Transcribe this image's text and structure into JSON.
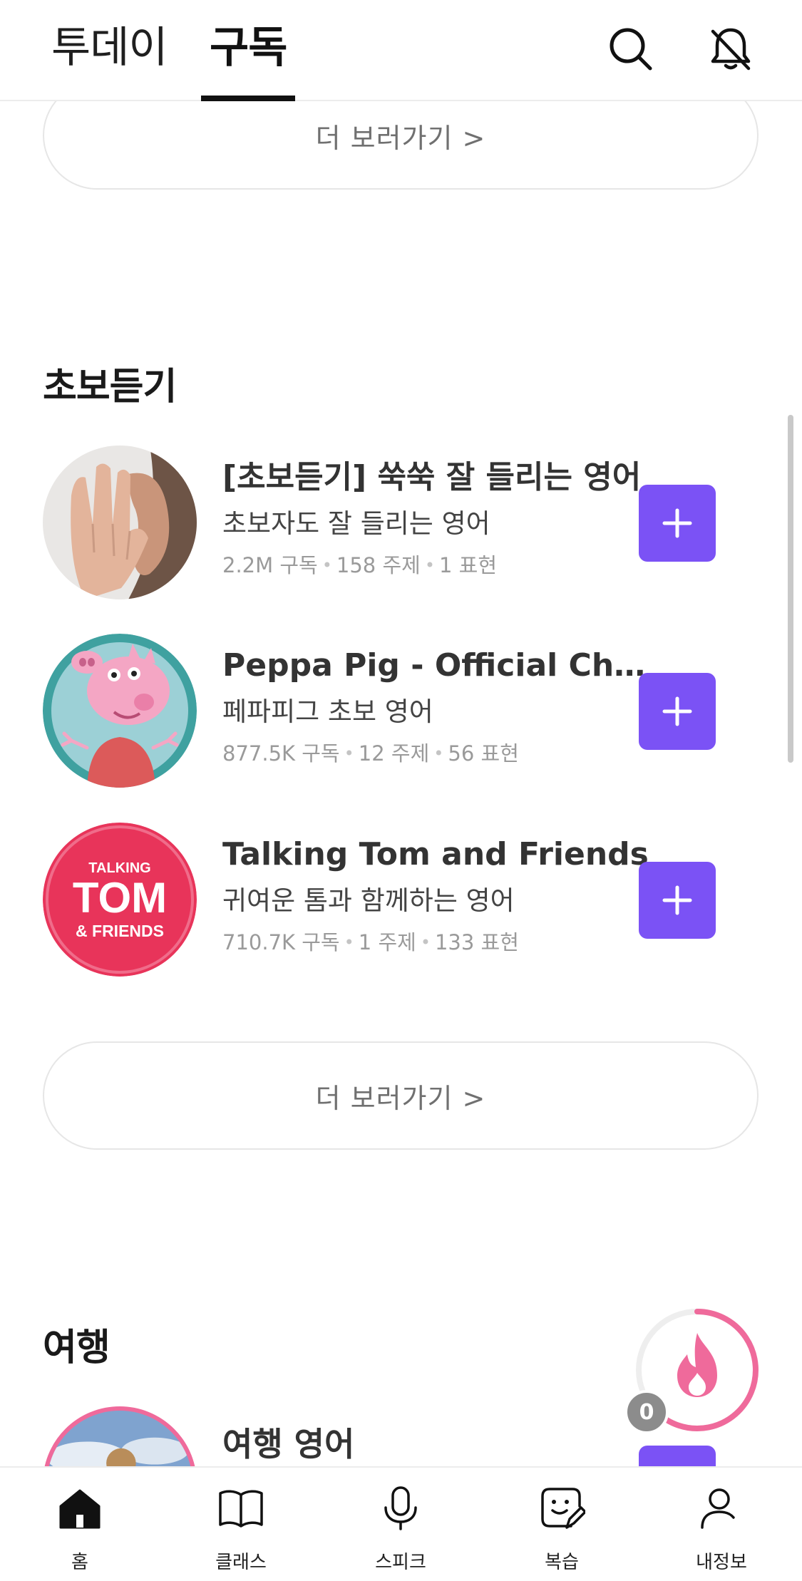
{
  "header": {
    "tabs": [
      {
        "label": "투데이",
        "active": false
      },
      {
        "label": "구독",
        "active": true
      }
    ],
    "icons": [
      "search-icon",
      "bell-off-icon"
    ]
  },
  "more_label": "더 보러가기  >",
  "sections": {
    "beginner": {
      "title": "초보듣기",
      "channels": [
        {
          "title": "[초보듣기] 쑥쑥 잘 들리는 영어",
          "subtitle": "초보자도 잘 들리는 영어",
          "subscribers": "2.2M 구독",
          "topics": "158 주제",
          "expressions": "1 표현"
        },
        {
          "title": "Peppa Pig - Official Channel",
          "subtitle": "페파피그 초보 영어",
          "subscribers": "877.5K 구독",
          "topics": "12 주제",
          "expressions": "56 표현"
        },
        {
          "title": "Talking Tom and Friends",
          "subtitle": "귀여운 톰과 함께하는 영어",
          "subscribers": "710.7K 구독",
          "topics": "1 주제",
          "expressions": "133 표현",
          "logo_text": [
            "TALKING",
            "TOM",
            "& FRIENDS"
          ]
        }
      ]
    },
    "travel": {
      "title": "여행",
      "channels": [
        {
          "title": "여행 영어"
        }
      ]
    }
  },
  "streak": {
    "count": "0",
    "icon": "flame-icon"
  },
  "bottom_nav": [
    {
      "label": "홈",
      "icon": "home-icon",
      "active": true
    },
    {
      "label": "클래스",
      "icon": "book-icon"
    },
    {
      "label": "스피크",
      "icon": "mic-icon"
    },
    {
      "label": "복습",
      "icon": "review-icon"
    },
    {
      "label": "내정보",
      "icon": "profile-icon"
    }
  ],
  "colors": {
    "accent_purple": "#7b52f5",
    "streak_pink": "#ef6a9b",
    "tom_red": "#e8345a",
    "peppa_teal": "#3fa1a0"
  }
}
